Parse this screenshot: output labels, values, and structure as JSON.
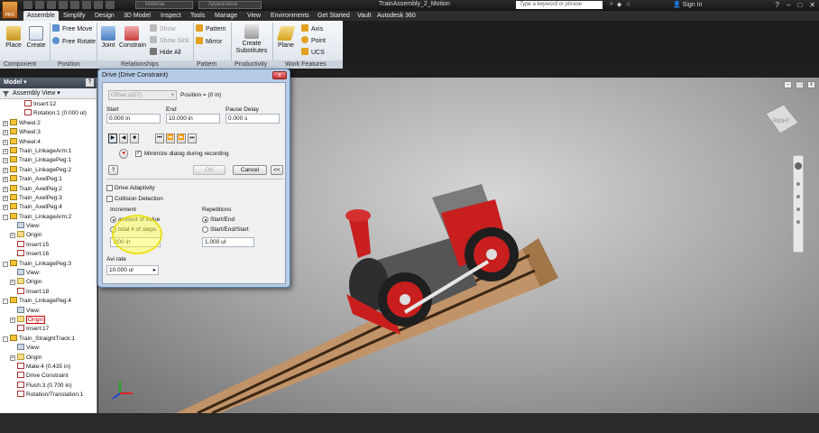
{
  "window": {
    "app_badge": "PRO",
    "title": "TrainAssembly_2_Motion",
    "search_placeholder": "Type a keyword or phrase",
    "sign_in": "Sign In",
    "material_combo": "Material",
    "appearance_combo": "Appearance"
  },
  "tabs": [
    "Assemble",
    "Simplify",
    "Design",
    "3D Model",
    "Inspect",
    "Tools",
    "Manage",
    "View",
    "Environments",
    "Get Started",
    "Vault",
    "Autodesk 360"
  ],
  "ribbon": {
    "place": "Place",
    "create": "Create",
    "free_move": "Free Move",
    "free_rotate": "Free Rotate",
    "joint": "Joint",
    "constrain": "Constrain",
    "show": "Show",
    "show_sick": "Show Sick",
    "hide_all": "Hide All",
    "pattern": "Pattern",
    "mirror": "Mirror",
    "create_substitutes_1": "Create",
    "create_substitutes_2": "Substitutes",
    "plane": "Plane",
    "axis": "Axis",
    "point": "Point",
    "ucs": "UCS",
    "groups": [
      "Component",
      "Position",
      "Relationships",
      "Pattern",
      "Productivity",
      "Work Features"
    ]
  },
  "browser": {
    "title": "Model",
    "view": "Assembly View",
    "help": "?",
    "items": [
      {
        "label": "Insert:12",
        "indent": 3,
        "icon": "con",
        "exp": ""
      },
      {
        "label": "Rotation:1 (0.000 ul)",
        "indent": 3,
        "icon": "con",
        "exp": ""
      },
      {
        "label": "Wheel:2",
        "indent": 0,
        "icon": "part",
        "exp": "+"
      },
      {
        "label": "Wheel:3",
        "indent": 0,
        "icon": "part",
        "exp": "+"
      },
      {
        "label": "Wheel:4",
        "indent": 0,
        "icon": "part",
        "exp": "+"
      },
      {
        "label": "Train_LinkageArm:1",
        "indent": 0,
        "icon": "part",
        "exp": "+"
      },
      {
        "label": "Train_LinkagePeg:1",
        "indent": 0,
        "icon": "part",
        "exp": "+"
      },
      {
        "label": "Train_LinkagePeg:2",
        "indent": 0,
        "icon": "part",
        "exp": "+"
      },
      {
        "label": "Train_AxelPeg:1",
        "indent": 0,
        "icon": "part",
        "exp": "+"
      },
      {
        "label": "Train_AxelPeg:2",
        "indent": 0,
        "icon": "part",
        "exp": "+"
      },
      {
        "label": "Train_AxelPeg:3",
        "indent": 0,
        "icon": "part",
        "exp": "+"
      },
      {
        "label": "Train_AxelPeg:4",
        "indent": 0,
        "icon": "part",
        "exp": "+"
      },
      {
        "label": "Train_LinkageArm:2",
        "indent": 0,
        "icon": "part",
        "exp": "-"
      },
      {
        "label": "View:",
        "indent": 2,
        "icon": "view",
        "exp": ""
      },
      {
        "label": "Origin",
        "indent": 1,
        "icon": "folder",
        "exp": "+"
      },
      {
        "label": "Insert:15",
        "indent": 2,
        "icon": "con",
        "exp": ""
      },
      {
        "label": "Insert:16",
        "indent": 2,
        "icon": "con",
        "exp": ""
      },
      {
        "label": "Train_LinkagePeg:3",
        "indent": 0,
        "icon": "part",
        "exp": "-"
      },
      {
        "label": "View:",
        "indent": 2,
        "icon": "view",
        "exp": ""
      },
      {
        "label": "Origin",
        "indent": 1,
        "icon": "folder",
        "exp": "+"
      },
      {
        "label": "Insert:18",
        "indent": 2,
        "icon": "con",
        "exp": ""
      },
      {
        "label": "Train_LinkagePeg:4",
        "indent": 0,
        "icon": "part",
        "exp": "-"
      },
      {
        "label": "View:",
        "indent": 2,
        "icon": "view",
        "exp": ""
      },
      {
        "label": "Origin",
        "indent": 1,
        "icon": "folder",
        "exp": "+",
        "selected": true
      },
      {
        "label": "Insert:17",
        "indent": 2,
        "icon": "con",
        "exp": ""
      },
      {
        "label": "Train_StraightTrack:1",
        "indent": 0,
        "icon": "part",
        "exp": "-"
      },
      {
        "label": "View:",
        "indent": 2,
        "icon": "view",
        "exp": ""
      },
      {
        "label": "Origin",
        "indent": 1,
        "icon": "folder",
        "exp": "+"
      },
      {
        "label": "Mate:4 (0.435 in)",
        "indent": 2,
        "icon": "con",
        "exp": ""
      },
      {
        "label": "Drive Constraint",
        "indent": 2,
        "icon": "con",
        "exp": ""
      },
      {
        "label": "Flush:3 (0.700 in)",
        "indent": 2,
        "icon": "con",
        "exp": ""
      },
      {
        "label": "Rotation/Translation:1",
        "indent": 2,
        "icon": "con",
        "exp": ""
      }
    ]
  },
  "dialog": {
    "title": "Drive (Drive Constraint)",
    "close": "x",
    "offset_select": "Offset (d27)",
    "position_label": "Position = (0 in)",
    "start_label": "Start",
    "start_value": "0.000 in",
    "end_label": "End",
    "end_value": "10.000 in",
    "pause_label": "Pause Delay",
    "pause_value": "0.000 s",
    "minimize_label": "Minimize dialog during recording",
    "minimize_checked": "✓",
    "ok": "OK",
    "cancel": "Cancel",
    "collapse": "<<",
    "help": "?",
    "drive_adaptivity": "Drive Adaptivity",
    "collision_detection": "Collision Detection",
    "increment_label": "Increment",
    "amount_of_value": "amount of value",
    "total_steps": "total # of steps",
    "increment_value": ".000 in",
    "repetitions_label": "Repetitions",
    "start_end": "Start/End",
    "start_end_start": "Start/End/Start",
    "repetitions_value": "1.000 ul",
    "avi_rate_label": "Avi rate",
    "avi_rate_value": "10.000 ul"
  },
  "viewcube_label": "RIGHT",
  "colors": {
    "accent": "#c00000",
    "dialog_frame": "#b6cce4",
    "highlight": "#ffff3c"
  }
}
